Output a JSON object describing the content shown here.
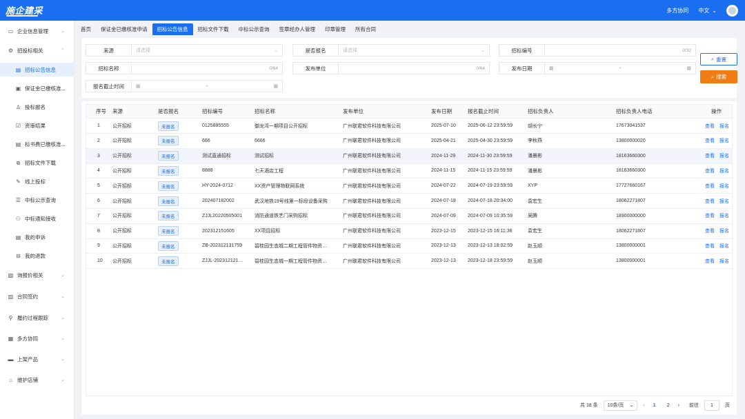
{
  "header": {
    "logo": "施企建采",
    "collab": "多方协同",
    "language": "中文"
  },
  "sidebar": {
    "items": [
      {
        "label": "企业信息管理",
        "icon": "folder-icon",
        "expandable": true
      },
      {
        "label": "招投标相关",
        "icon": "settings-icon",
        "expandable": true,
        "expanded": true
      },
      {
        "label": "招标公告信息",
        "icon": "doc-icon",
        "sub": true,
        "active": true
      },
      {
        "label": "保证金已缴核准...",
        "icon": "clipboard-icon",
        "sub": true
      },
      {
        "label": "投标报名",
        "icon": "user-icon",
        "sub": true
      },
      {
        "label": "资审结果",
        "icon": "check-icon",
        "sub": true
      },
      {
        "label": "标书费已缴核准...",
        "icon": "doc-icon",
        "sub": true
      },
      {
        "label": "招标文件下载",
        "icon": "org-icon",
        "sub": true
      },
      {
        "label": "线上投标",
        "icon": "edit-icon",
        "sub": true
      },
      {
        "label": "中标公示查询",
        "icon": "list-icon",
        "sub": true
      },
      {
        "label": "中标通知接收",
        "icon": "users-icon",
        "sub": true
      },
      {
        "label": "我的申诉",
        "icon": "doc-icon",
        "sub": true
      },
      {
        "label": "我的退款",
        "icon": "refund-icon",
        "sub": true
      },
      {
        "label": "询报价相关",
        "icon": "quote-icon",
        "expandable": true
      },
      {
        "label": "合同签约",
        "icon": "contract-icon",
        "expandable": true
      },
      {
        "label": "履约过程跟踪",
        "icon": "track-icon",
        "expandable": true
      },
      {
        "label": "多方协同",
        "icon": "collab-icon",
        "expandable": true
      },
      {
        "label": "上架产品",
        "icon": "product-icon",
        "expandable": true
      },
      {
        "label": "维护店铺",
        "icon": "store-icon",
        "expandable": true
      }
    ]
  },
  "tabs": [
    "首页",
    "保证金已缴核准申请",
    "招标公告信息",
    "招标文件下载",
    "中标公示查询",
    "签章经办人管理",
    "印章管理",
    "所有合同"
  ],
  "active_tab": 2,
  "filters": {
    "source_label": "来源",
    "source_placeholder": "请选择",
    "registered_label": "是否报名",
    "registered_placeholder": "请选择",
    "bid_no_label": "招标编号",
    "bid_no_count": "0/32",
    "bid_name_label": "招标名称",
    "bid_name_count": "0/64",
    "publisher_label": "发布单位",
    "publisher_count": "0/64",
    "publish_date_label": "发布日期",
    "reg_deadline_label": "报名截止时间",
    "date_sep": "-",
    "reset_label": "重置",
    "search_label": "搜索"
  },
  "table": {
    "columns": [
      "序号",
      "来源",
      "是否报名",
      "招标编号",
      "招标名称",
      "发布单位",
      "发布日期",
      "报名截止时间",
      "招标负责人",
      "招标负责人电话",
      "操作"
    ],
    "action_view": "查看",
    "action_register": "报名",
    "rows": [
      {
        "no": "1",
        "source": "公开招标",
        "status": "未报名",
        "code": "0125885555",
        "name": "御龙湾一期项目公开招标",
        "unit": "广州联君软件科技有限公司",
        "date": "2025-07-10",
        "deadline": "2025-06-12 23:59:59",
        "owner": "胡长宁",
        "phone": "17673041537"
      },
      {
        "no": "2",
        "source": "公开招标",
        "status": "未报名",
        "code": "666",
        "name": "6666",
        "unit": "广州联君软件科技有限公司",
        "date": "2025-04-21",
        "deadline": "2025-04-30 23:59:59",
        "owner": "李秋燕",
        "phone": "13800000020"
      },
      {
        "no": "3",
        "source": "公开招标",
        "status": "未报名",
        "code": "测试直通招标",
        "name": "测试招标",
        "unit": "广州联君软件科技有限公司",
        "date": "2024-11-29",
        "deadline": "2024-11-30 23:59:59",
        "owner": "潘晨彬",
        "phone": "18163660300"
      },
      {
        "no": "4",
        "source": "公开招标",
        "status": "未报名",
        "code": "8888",
        "name": "七天酒店工程",
        "unit": "广州联君软件科技有限公司",
        "date": "2024-11-15",
        "deadline": "2024-11-15 23:59:59",
        "owner": "潘晨彬",
        "phone": "18163660300"
      },
      {
        "no": "5",
        "source": "公开招标",
        "status": "未报名",
        "code": "HY-2024-0712",
        "name": "XX资产管理物联网系统",
        "unit": "广州联君软件科技有限公司",
        "date": "2024-07-22",
        "deadline": "2024-07-19 23:59:59",
        "owner": "XYP",
        "phone": "17727660167"
      },
      {
        "no": "6",
        "source": "公开招标",
        "status": "未报名",
        "code": "202407182002",
        "name": "武汉地铁19号线第一标段设备采购",
        "unit": "广州联君软件科技有限公司",
        "date": "2024-07-18",
        "deadline": "2024-07-18 20:34:00",
        "owner": "袁宏生",
        "phone": "18062271807"
      },
      {
        "no": "7",
        "source": "公开招标",
        "status": "未报名",
        "code": "ZJJL20220505001",
        "name": "消防通道铁艺门采购招标",
        "unit": "广州联君软件科技有限公司",
        "date": "2024-07-09",
        "deadline": "2024-07-09 10:35:59",
        "owner": "吴腾",
        "phone": "18900000000"
      },
      {
        "no": "8",
        "source": "公开招标",
        "status": "未报名",
        "code": "202312151605",
        "name": "XX项目招标",
        "unit": "广州联君软件科技有限公司",
        "date": "2023-12-15",
        "deadline": "2023-12-15 16:11:36",
        "owner": "袁宏生",
        "phone": "18062271807"
      },
      {
        "no": "9",
        "source": "公开招标",
        "status": "未报名",
        "code": "ZB-202312131759",
        "name": "碧桂园生态城二期工程管件物资…",
        "unit": "广州联君软件科技有限公司",
        "date": "2023-12-13",
        "deadline": "2023-12-13 18:02:59",
        "owner": "赵玉顺",
        "phone": "13800000001"
      },
      {
        "no": "10",
        "source": "公开招标",
        "status": "未报名",
        "code": "ZJJL-202312121…",
        "name": "碧桂园生态城一期工程管件物资…",
        "unit": "广州联君软件科技有限公司",
        "date": "2023-12-13",
        "deadline": "2023-12-18 23:59:59",
        "owner": "赵玉顺",
        "phone": "13800000001"
      }
    ]
  },
  "pagination": {
    "total": "共 18 条",
    "page_size": "10条/页",
    "pages": [
      "1",
      "2"
    ],
    "current": "1",
    "goto_label": "前往",
    "goto_value": "1",
    "page_unit": "页"
  }
}
